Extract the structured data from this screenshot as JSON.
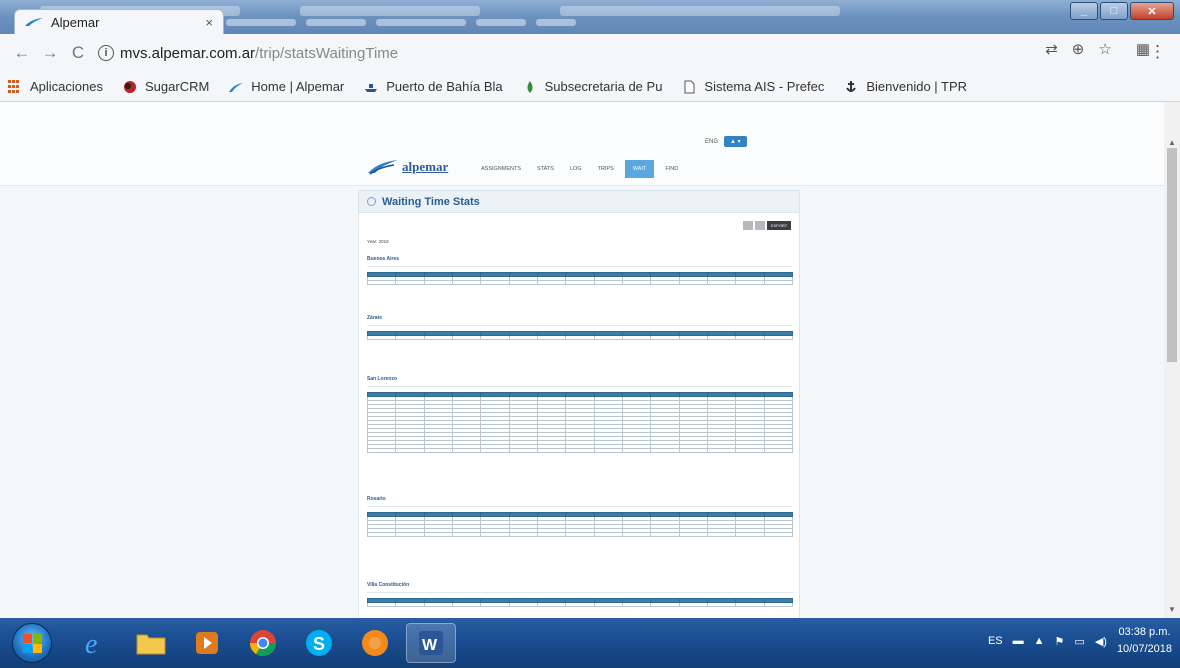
{
  "browser": {
    "tab": {
      "title": "Alpemar",
      "close": "×"
    },
    "nav": {
      "back": "←",
      "forward": "→",
      "reload": "C"
    },
    "url": {
      "host": "mvs.alpemar.com.ar",
      "path": "/trip/statsWaitingTime"
    },
    "bookmarks": [
      {
        "label": "Aplicaciones",
        "icon": "apps-icon"
      },
      {
        "label": "SugarCRM",
        "icon": "sugarcrm-icon"
      },
      {
        "label": "Home | Alpemar",
        "icon": "alpemar-icon"
      },
      {
        "label": "Puerto de Bahía Bla",
        "icon": "ship-icon"
      },
      {
        "label": "Subsecretaria de Pu",
        "icon": "drop-icon"
      },
      {
        "label": "Sistema AIS - Prefec",
        "icon": "page-icon"
      },
      {
        "label": "Bienvenido | TPR",
        "icon": "anchor-icon"
      }
    ]
  },
  "app": {
    "logo_text": "alpemar",
    "lang": "ENG",
    "nav": [
      "ASSIGNMENTS",
      "STATS",
      "LOG",
      "TRIPS",
      "WAIT",
      "FIND"
    ],
    "panel_title": "Waiting Time Stats",
    "export_label": "EXPORT",
    "year": "Year: 2018",
    "ports": [
      {
        "name": "Buenos Aires",
        "rows": 2
      },
      {
        "name": "Zárate",
        "rows": 1
      },
      {
        "name": "San Lorenzo",
        "rows": 14
      },
      {
        "name": "Rosario",
        "rows": 5
      },
      {
        "name": "Villa Constitución",
        "rows": 1
      }
    ]
  },
  "taskbar": {
    "lang": "ES",
    "time": "03:38 p.m.",
    "date": "10/07/2018"
  },
  "colors": {
    "accent": "#2f84c4",
    "table_header": "#3a7fa8",
    "taskbar": "#1b4f93"
  }
}
